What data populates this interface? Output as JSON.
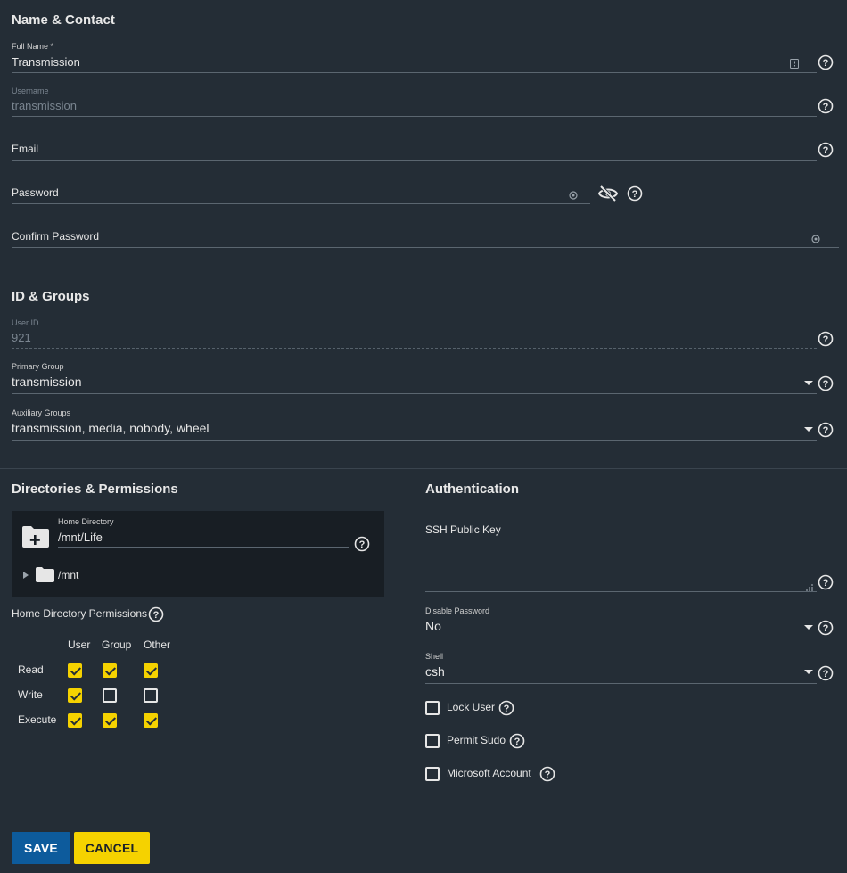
{
  "name_contact": {
    "title": "Name & Contact",
    "full_name": {
      "label": "Full Name *",
      "value": "Transmission"
    },
    "username": {
      "label": "Username",
      "value": "transmission"
    },
    "email": {
      "label": "Email",
      "value": ""
    },
    "password": {
      "label": "Password",
      "value": ""
    },
    "confirm_password": {
      "label": "Confirm Password",
      "value": ""
    }
  },
  "id_groups": {
    "title": "ID & Groups",
    "user_id": {
      "label": "User ID",
      "value": "921"
    },
    "primary_group": {
      "label": "Primary Group",
      "value": "transmission"
    },
    "aux_groups": {
      "label": "Auxiliary Groups",
      "value": "transmission, media, nobody, wheel"
    }
  },
  "dirs": {
    "title": "Directories & Permissions",
    "home_dir": {
      "label": "Home Directory",
      "value": "/mnt/Life"
    },
    "tree_node": "/mnt",
    "perm_title": "Home Directory Permissions",
    "columns": [
      "User",
      "Group",
      "Other"
    ],
    "rows": [
      {
        "label": "Read",
        "values": [
          true,
          true,
          true
        ]
      },
      {
        "label": "Write",
        "values": [
          true,
          false,
          false
        ]
      },
      {
        "label": "Execute",
        "values": [
          true,
          true,
          true
        ]
      }
    ]
  },
  "auth": {
    "title": "Authentication",
    "ssh_key": {
      "label": "SSH Public Key",
      "value": ""
    },
    "disable_password": {
      "label": "Disable Password",
      "value": "No"
    },
    "shell": {
      "label": "Shell",
      "value": "csh"
    },
    "lock_user": {
      "label": "Lock User",
      "checked": false
    },
    "permit_sudo": {
      "label": "Permit Sudo",
      "checked": false
    },
    "microsoft_account": {
      "label": "Microsoft Account",
      "checked": false
    }
  },
  "actions": {
    "save": "SAVE",
    "cancel": "CANCEL"
  },
  "colors": {
    "accent": "#f5d200",
    "primary": "#0d5b9c",
    "background": "#242d36"
  }
}
